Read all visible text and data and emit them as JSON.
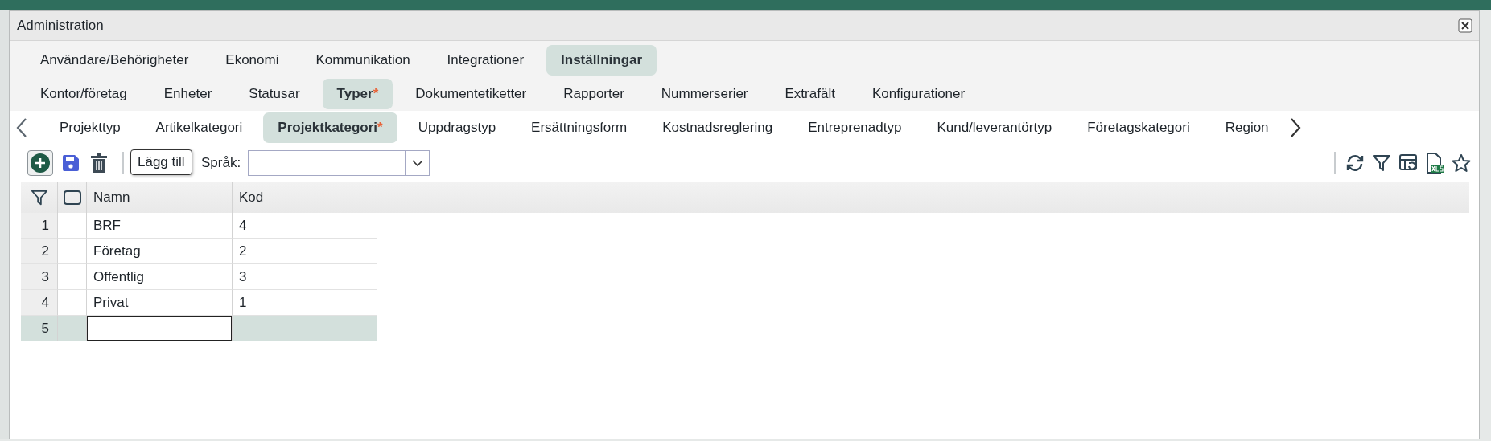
{
  "window": {
    "title": "Administration"
  },
  "main_tabs": [
    {
      "label": "Användare/Behörigheter",
      "selected": false
    },
    {
      "label": "Ekonomi",
      "selected": false
    },
    {
      "label": "Kommunikation",
      "selected": false
    },
    {
      "label": "Integrationer",
      "selected": false
    },
    {
      "label": "Inställningar",
      "selected": true
    }
  ],
  "sub_tabs": [
    {
      "label": "Kontor/företag",
      "selected": false
    },
    {
      "label": "Enheter",
      "selected": false
    },
    {
      "label": "Statusar",
      "selected": false
    },
    {
      "label": "Typer",
      "marker": "*",
      "selected": true
    },
    {
      "label": "Dokumentetiketter",
      "selected": false
    },
    {
      "label": "Rapporter",
      "selected": false
    },
    {
      "label": "Nummerserier",
      "selected": false
    },
    {
      "label": "Extrafält",
      "selected": false
    },
    {
      "label": "Konfigurationer",
      "selected": false
    }
  ],
  "type_tabs": [
    {
      "label": "Projekttyp",
      "selected": false
    },
    {
      "label": "Artikelkategori",
      "selected": false
    },
    {
      "label": "Projektkategori",
      "marker": "*",
      "selected": true
    },
    {
      "label": "Uppdragstyp",
      "selected": false
    },
    {
      "label": "Ersättningsform",
      "selected": false
    },
    {
      "label": "Kostnadsreglering",
      "selected": false
    },
    {
      "label": "Entreprenadtyp",
      "selected": false
    },
    {
      "label": "Kund/leverantörtyp",
      "selected": false
    },
    {
      "label": "Företagskategori",
      "selected": false
    },
    {
      "label": "Region",
      "selected": false
    }
  ],
  "toolbar": {
    "language_label": "Språk:"
  },
  "tooltip": {
    "text": "Lägg till"
  },
  "table": {
    "columns": [
      "Namn",
      "Kod"
    ],
    "rows": [
      {
        "number": "1",
        "name": "BRF",
        "code": "4",
        "selected": false
      },
      {
        "number": "2",
        "name": "Företag",
        "code": "2",
        "selected": false
      },
      {
        "number": "3",
        "name": "Offentlig",
        "code": "3",
        "selected": false
      },
      {
        "number": "4",
        "name": "Privat",
        "code": "1",
        "selected": false
      },
      {
        "number": "5",
        "kind": "new",
        "selected": true
      }
    ]
  }
}
